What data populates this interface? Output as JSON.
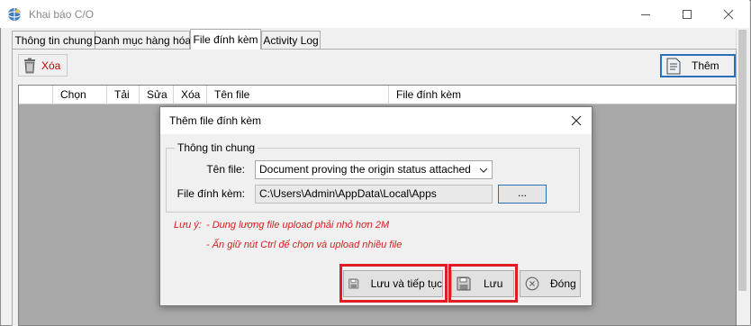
{
  "window": {
    "title": "Khai báo C/O",
    "controls": {
      "minimize": "minimize-icon",
      "maximize": "maximize-icon",
      "close": "close-icon"
    }
  },
  "tabs": [
    {
      "label": "Thông tin chung",
      "active": false
    },
    {
      "label": "Danh mục hàng hóa",
      "active": false
    },
    {
      "label": "File đính kèm",
      "active": true
    },
    {
      "label": "Activity Log",
      "active": false
    }
  ],
  "toolbar": {
    "delete_label": "Xóa",
    "add_label": "Thêm",
    "delete_icon": "trash-icon",
    "add_icon": "document-icon"
  },
  "grid": {
    "columns": [
      "Chọn",
      "Tải",
      "Sửa",
      "Xóa",
      "Tên file",
      "File đính kèm"
    ],
    "rows": []
  },
  "dialog": {
    "title": "Thêm file đính kèm",
    "group_title": "Thông tin chung",
    "file_name_label": "Tên file:",
    "file_name_value": "Document proving the origin status attached",
    "attach_label": "File đính kèm:",
    "attach_value": "C:\\Users\\Admin\\AppData\\Local\\Apps",
    "browse_label": "...",
    "note_label": "Lưu ý:",
    "note_lines": [
      "- Dung lượng file upload phải nhỏ hơn 2M",
      "- Ấn giữ nút Ctrl để chọn và upload nhiều file"
    ],
    "buttons": {
      "save_continue": "Lưu và tiếp tục",
      "save": "Lưu",
      "close": "Đóng"
    }
  },
  "colors": {
    "highlight": "#e01d25",
    "note_text": "#d32020",
    "focus_border": "#2b6fb8",
    "grid_background": "#a9a9a9"
  }
}
